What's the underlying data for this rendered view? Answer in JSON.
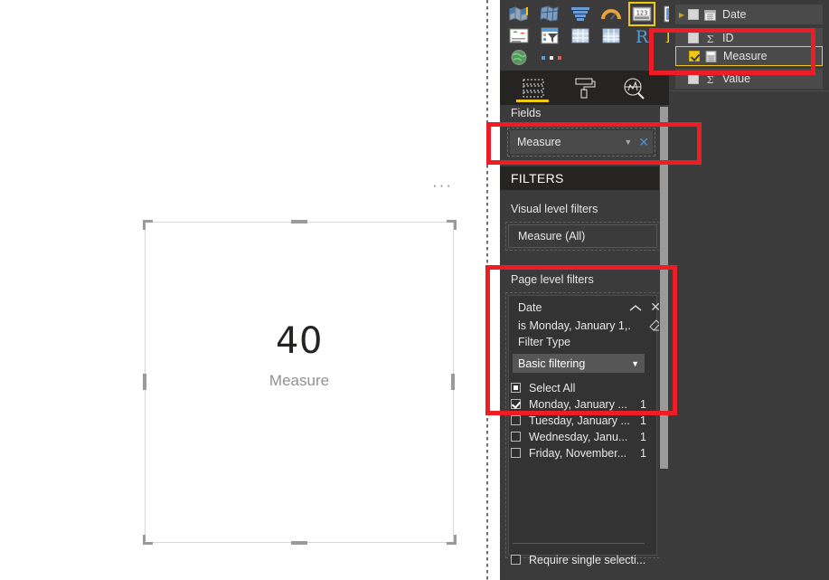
{
  "canvas": {
    "visual": {
      "value": "40",
      "label": "Measure",
      "ellipsis": "···"
    }
  },
  "visualizations": {
    "gallery_icons": [
      "filled-map-icon",
      "shape-map-icon",
      "funnel-icon",
      "gauge-icon",
      "card-icon",
      "multi-row-card-icon",
      "kpi-icon",
      "slicer-icon",
      "table-icon",
      "matrix-icon",
      "r-script-visual-icon",
      "python-visual-icon",
      "arcgis-map-icon",
      "more-visuals-icon"
    ],
    "selected_icon": "card-icon",
    "tabs": [
      {
        "name": "fields-tab",
        "icon": "fields-icon",
        "selected": true
      },
      {
        "name": "format-tab",
        "icon": "paint-roller-icon",
        "selected": false
      },
      {
        "name": "analytics-tab",
        "icon": "magnifier-chart-icon",
        "selected": false
      }
    ],
    "fields_header": "Fields",
    "field_well": {
      "chip_label": "Measure",
      "caret_icon": "chevron-down-icon",
      "close_icon": "close-icon"
    }
  },
  "filters": {
    "title": "FILTERS",
    "visual_level": {
      "label": "Visual level filters",
      "chip": "Measure  (All)"
    },
    "page_level": {
      "label": "Page level filters",
      "card": {
        "field_name": "Date",
        "collapse_icon": "chevron-up-icon",
        "close_icon": "close-icon",
        "condition": "is Monday, January 1,...",
        "clear_icon": "eraser-icon",
        "filter_type_label": "Filter Type",
        "filter_type_value": "Basic filtering",
        "filter_type_caret": "chevron-down-icon",
        "items": [
          {
            "label": "Select All",
            "count": "",
            "state": "partial"
          },
          {
            "label": "Monday, January ...",
            "count": "1",
            "state": "checked"
          },
          {
            "label": "Tuesday, January ...",
            "count": "1",
            "state": "unchecked"
          },
          {
            "label": "Wednesday, Janu...",
            "count": "1",
            "state": "unchecked"
          },
          {
            "label": "Friday, November...",
            "count": "1",
            "state": "unchecked"
          }
        ],
        "require_single": "Require single selecti..."
      }
    }
  },
  "fields_pane": {
    "rows": [
      {
        "label": "Date",
        "checked": false,
        "icon": "calendar-icon",
        "expander": true,
        "selected": false
      },
      {
        "label": "ID",
        "checked": false,
        "icon": "sigma-icon",
        "expander": false,
        "selected": false
      },
      {
        "label": "Measure",
        "checked": true,
        "icon": "calculator-icon",
        "expander": false,
        "selected": true
      },
      {
        "label": "Value",
        "checked": false,
        "icon": "sigma-icon",
        "expander": false,
        "selected": false
      }
    ]
  },
  "annotations": {
    "accent_red": "#ee1c25",
    "accent_yellow": "#f2c811",
    "boxes": [
      {
        "name": "measure-field-well-highlight"
      },
      {
        "name": "page-level-filters-highlight"
      },
      {
        "name": "fields-measure-highlight"
      }
    ]
  }
}
